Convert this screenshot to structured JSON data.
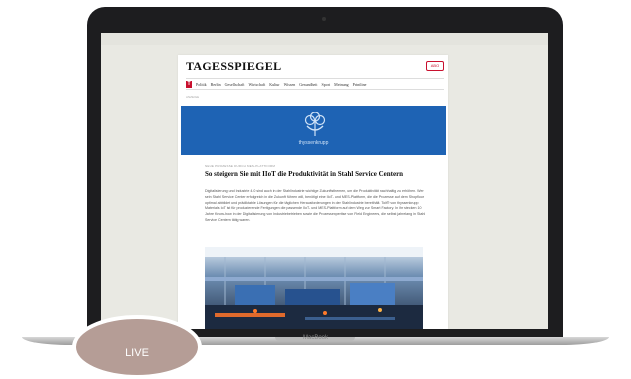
{
  "device": {
    "label": "MacBook"
  },
  "article_page": {
    "masthead": "TAGESSPIEGEL",
    "abo_label": "ABO",
    "nav_logo": "T",
    "nav_items": [
      "Politik",
      "Berlin",
      "Gesellschaft",
      "Wirtschaft",
      "Kultur",
      "Wissen",
      "Gesundheit",
      "Sport",
      "Meinung",
      "Printline"
    ],
    "kicker": "ANZEIGE",
    "banner": {
      "brand": "thyssenkrupp",
      "color": "#1e63b4"
    },
    "eyebrow": "NEUE PROZESSE DURCH MES-PLATTFORM",
    "headline": "So steigern Sie mit IIoT die Produktivität in Stahl Service Centern",
    "body": "Digitalisierung und Industrie 4.0 sind auch in der Stahlindustrie wichtige Zukunftsthemen, um die Produktivität nachhaltig zu erhöhen. Wer sein Stahl Service Center erfolgreich in die Zukunft führen will, benötigt eine IIoT- und MES-Plattform, die die Prozesse auf dem Shopfloor optimal abbildet und prädiktable Lösungen für die täglichen Herausforderungen in der Stahlindustrie bereithält. Toii® von thyssenkrupp Materials IoT ist für produzierende Fertigungen die passende IIoT- und MES-Plattform auf dem Weg zur Smart Factory. In ihr stecken 10 Jahre Know-how in der Digitalisierung von Industriebetrieben sowie die Prozessexpertise von Field Engineers, die selbst jahrelang in Stahl Service Centern tätig waren.",
    "photo_icon": "factory-floor-image"
  },
  "live_badge": {
    "label": "LIVE",
    "color": "#b59d96"
  }
}
